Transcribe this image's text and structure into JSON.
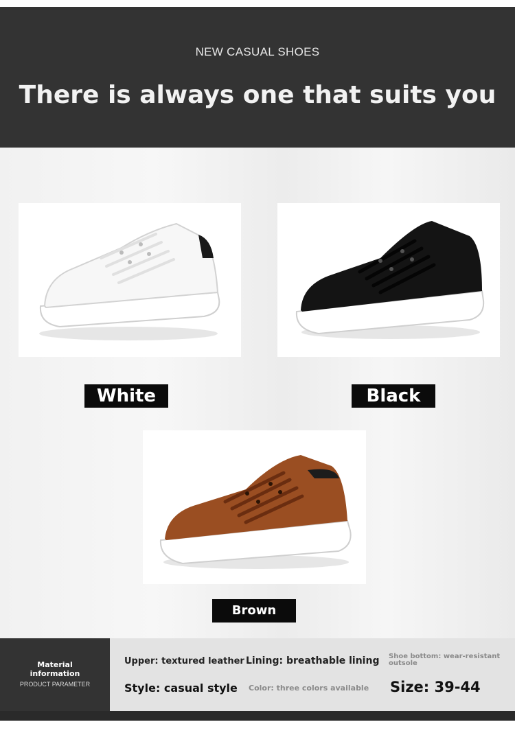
{
  "header": {
    "subtitle": "NEW CASUAL SHOES",
    "title": "There is always one that suits you"
  },
  "products": [
    {
      "color_name": "White",
      "shoe_color": "#f4f4f4"
    },
    {
      "color_name": "Black",
      "shoe_color": "#141414"
    },
    {
      "color_name": "Brown",
      "shoe_color": "#9a4e22"
    }
  ],
  "info": {
    "label_line1": "Material",
    "label_line2": "information",
    "label_sub": "PRODUCT PARAMETER",
    "upper": "Upper: textured leather",
    "lining": "Lining: breathable lining",
    "bottom": "Shoe bottom: wear-resistant outsole",
    "style": "Style: casual style",
    "color": "Color: three colors available",
    "size": "Size: 39-44"
  }
}
